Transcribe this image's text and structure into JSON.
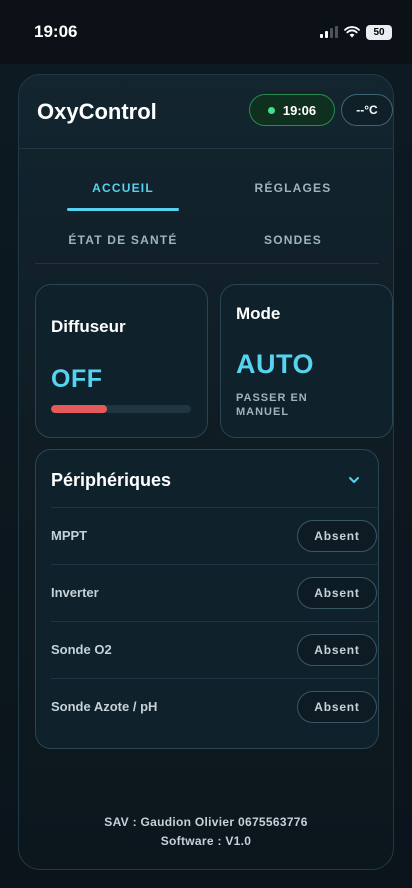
{
  "status_bar": {
    "time": "19:06",
    "battery": "50"
  },
  "header": {
    "title": "OxyControl",
    "clock": "19:06",
    "temperature": "--°C"
  },
  "tabs": [
    {
      "label": "ACCUEIL",
      "active": true
    },
    {
      "label": "RÉGLAGES",
      "active": false
    },
    {
      "label": "ÉTAT DE SANTÉ",
      "active": false
    },
    {
      "label": "SONDES",
      "active": false
    }
  ],
  "diffuser": {
    "title": "Diffuseur",
    "state": "OFF",
    "level_fraction": 0.4
  },
  "mode": {
    "title": "Mode",
    "value": "AUTO",
    "switch_label": "PASSER EN MANUEL"
  },
  "peripherals": {
    "title": "Périphériques",
    "items": [
      {
        "name": "MPPT",
        "status": "Absent"
      },
      {
        "name": "Inverter",
        "status": "Absent"
      },
      {
        "name": "Sonde O2",
        "status": "Absent"
      },
      {
        "name": "Sonde Azote / pH",
        "status": "Absent"
      }
    ]
  },
  "footer": {
    "support": "SAV : Gaudion Olivier 0675563776",
    "software": "Software : V1.0"
  },
  "colors": {
    "accent": "#56d3f0",
    "online": "#41e08a",
    "off_bar": "#e45a58"
  }
}
